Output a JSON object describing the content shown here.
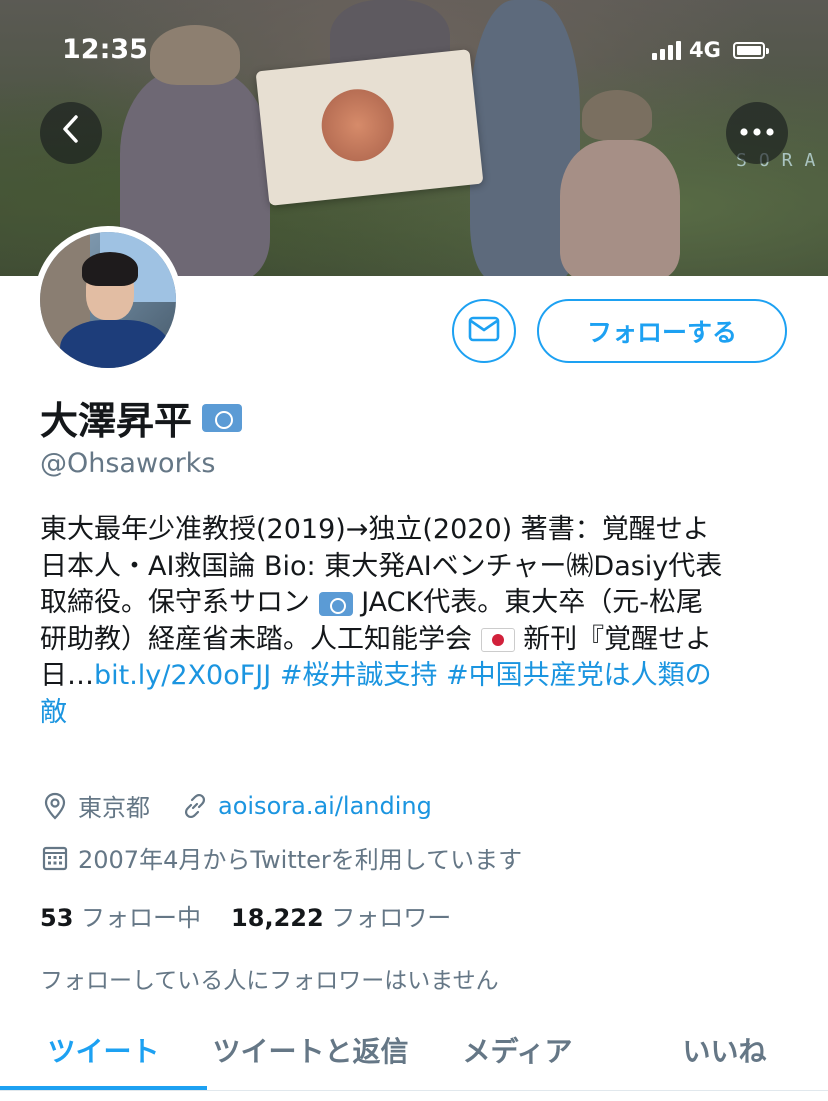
{
  "status_bar": {
    "time": "12:35",
    "network": "4G"
  },
  "banner": {
    "watermark": "SORA"
  },
  "nav": {
    "back_icon": "chevron-left-icon",
    "more_icon": "more-horizontal-icon"
  },
  "actions": {
    "message_icon": "mail-icon",
    "follow_label": "フォローする"
  },
  "profile": {
    "name": "大澤昇平",
    "handle": "@Ohsaworks",
    "bio": {
      "line1": "東大最年少准教授(2019)→独立(2020) 著書：覚醒せよ",
      "line2": "日本人・AI救国論 Bio: 東大発AIベンチャー㈱Dasiy代表",
      "line3a": "取締役。保守系サロン",
      "line3b": "JACK代表。東大卒（元-松尾",
      "line4a": "研助教）経産省未踏。人工知能学会",
      "line4b": "新刊『覚醒せよ",
      "line5": "日…",
      "link_url": "bit.ly/2X0oFJJ",
      "hashtag1": "#桜井誠支持",
      "hashtag2": "#中国共産党は人類の",
      "line6": "敵"
    },
    "location": "東京都",
    "website": "aoisora.ai/landing",
    "joined": "2007年4月からTwitterを利用しています",
    "following_count": "53",
    "following_label": "フォロー中",
    "followers_count": "18,222",
    "followers_label": "フォロワー",
    "mutual_note": "フォローしている人にフォロワーはいません"
  },
  "tabs": [
    {
      "label": "ツイート",
      "active": true
    },
    {
      "label": "ツイートと返信",
      "active": false
    },
    {
      "label": "メディア",
      "active": false
    },
    {
      "label": "いいね",
      "active": false
    }
  ],
  "colors": {
    "accent": "#1da1f2",
    "link": "#1b95e0",
    "secondary_text": "#657786"
  }
}
